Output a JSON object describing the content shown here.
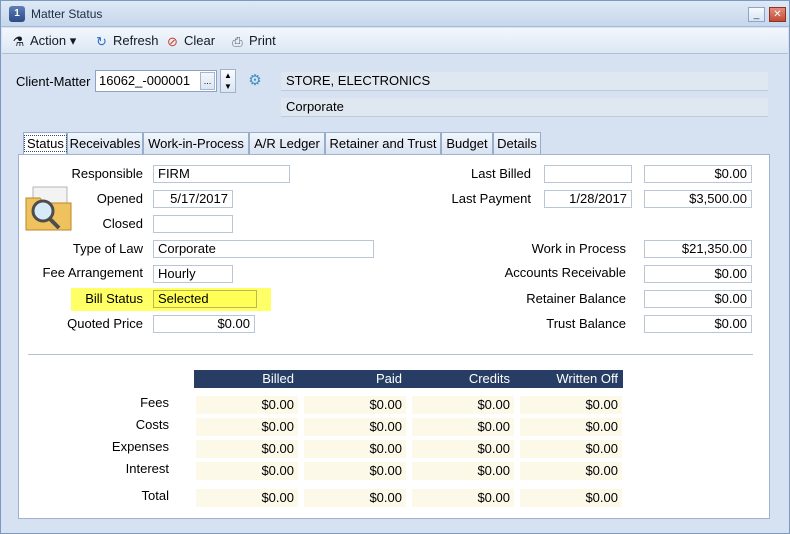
{
  "window": {
    "title": "Matter Status",
    "min": "_",
    "max": "□",
    "close": "✕"
  },
  "toolbar": {
    "action": "Action",
    "refresh": "Refresh",
    "clear": "Clear",
    "print": "Print"
  },
  "client": {
    "label": "Client-Matter",
    "value": "16062_-000001",
    "ellipsis": "...",
    "client_name": "STORE, ELECTRONICS",
    "matter_name": "Corporate"
  },
  "tabs": [
    "Status",
    "Receivables",
    "Work-in-Process",
    "A/R Ledger",
    "Retainer and Trust",
    "Budget",
    "Details"
  ],
  "status": {
    "responsible_label": "Responsible",
    "responsible": "FIRM",
    "opened_label": "Opened",
    "opened": "5/17/2017",
    "closed_label": "Closed",
    "closed": "",
    "type_label": "Type of Law",
    "type": "Corporate",
    "fee_label": "Fee Arrangement",
    "fee": "Hourly",
    "bill_label": "Bill Status",
    "bill": "Selected",
    "quoted_label": "Quoted Price",
    "quoted": "$0.00"
  },
  "right": {
    "last_billed_label": "Last Billed",
    "last_billed_date": "",
    "last_billed_amount": "$0.00",
    "last_payment_label": "Last Payment",
    "last_payment_date": "1/28/2017",
    "last_payment_amount": "$3,500.00",
    "wip_label": "Work in Process",
    "wip": "$21,350.00",
    "ar_label": "Accounts Receivable",
    "ar": "$0.00",
    "retainer_label": "Retainer Balance",
    "retainer": "$0.00",
    "trust_label": "Trust Balance",
    "trust": "$0.00"
  },
  "summary": {
    "headers": [
      "Billed",
      "Paid",
      "Credits",
      "Written Off"
    ],
    "rows": [
      {
        "label": "Fees",
        "values": [
          "$0.00",
          "$0.00",
          "$0.00",
          "$0.00"
        ]
      },
      {
        "label": "Costs",
        "values": [
          "$0.00",
          "$0.00",
          "$0.00",
          "$0.00"
        ]
      },
      {
        "label": "Expenses",
        "values": [
          "$0.00",
          "$0.00",
          "$0.00",
          "$0.00"
        ]
      },
      {
        "label": "Interest",
        "values": [
          "$0.00",
          "$0.00",
          "$0.00",
          "$0.00"
        ]
      },
      {
        "label": "Total",
        "values": [
          "$0.00",
          "$0.00",
          "$0.00",
          "$0.00"
        ]
      }
    ]
  }
}
